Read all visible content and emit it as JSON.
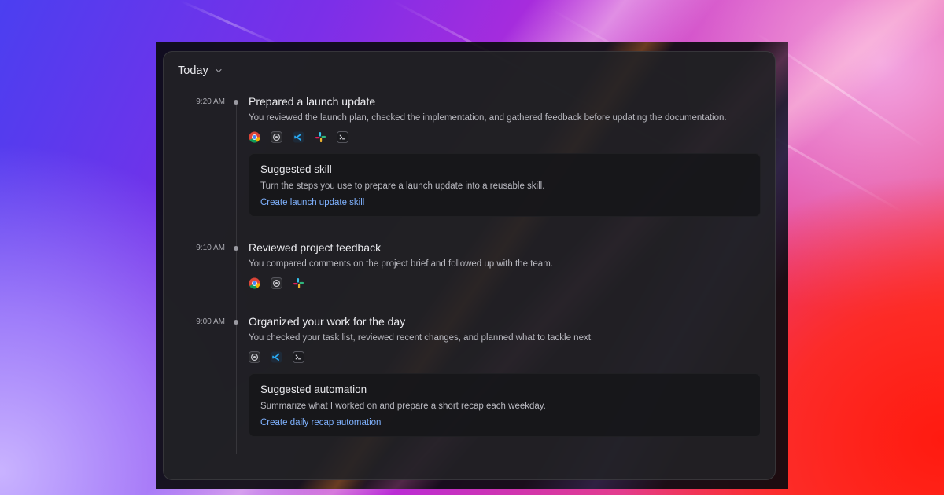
{
  "header": {
    "label": "Today"
  },
  "entries": [
    {
      "time": "9:20 AM",
      "title": "Prepared a launch update",
      "description": "You reviewed the launch plan, checked the implementation, and gathered feedback before updating the documentation.",
      "icons": [
        "chrome-icon",
        "settings-app-icon",
        "vscode-icon",
        "slack-icon",
        "terminal-icon"
      ],
      "card": {
        "title": "Suggested skill",
        "description": "Turn the steps you use to prepare a launch update into a reusable skill.",
        "link": "Create launch update skill"
      }
    },
    {
      "time": "9:10 AM",
      "title": "Reviewed project feedback",
      "description": "You compared comments on the project brief and followed up with the team.",
      "icons": [
        "chrome-icon",
        "settings-app-icon",
        "slack-icon"
      ]
    },
    {
      "time": "9:00 AM",
      "title": "Organized your work for the day",
      "description": "You checked your task list, reviewed recent changes, and planned what to tackle next.",
      "icons": [
        "settings-app-icon",
        "vscode-icon",
        "terminal-icon"
      ],
      "card": {
        "title": "Suggested automation",
        "description": "Summarize what I worked on and prepare a short recap each weekday.",
        "link": "Create daily recap automation"
      }
    }
  ],
  "colors": {
    "panel": "#222226",
    "link": "#7fb2ff",
    "text_primary": "#ececf0",
    "text_secondary": "#b9b9c0"
  }
}
